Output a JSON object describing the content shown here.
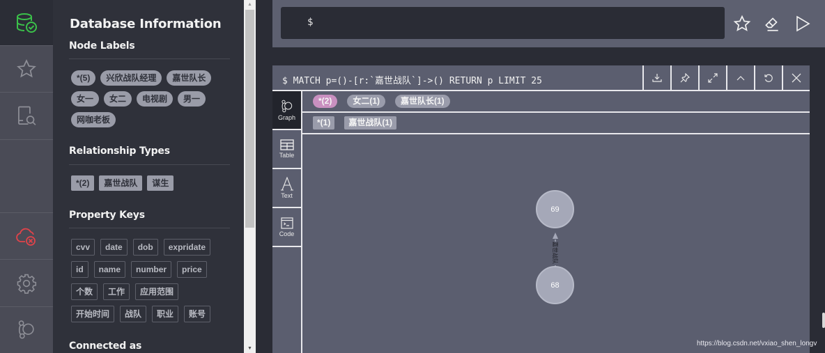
{
  "nav": {
    "items": [
      {
        "name": "database",
        "icon": "database-check-icon",
        "active": true
      },
      {
        "name": "favorites",
        "icon": "star-icon",
        "active": false
      },
      {
        "name": "documents",
        "icon": "document-search-icon",
        "active": false
      },
      {
        "name": "connection",
        "icon": "cloud-disconnected-icon",
        "active": false
      },
      {
        "name": "settings",
        "icon": "gear-icon",
        "active": false
      },
      {
        "name": "about",
        "icon": "neo4j-graph-icon",
        "active": false
      }
    ],
    "colors": {
      "db_ok": "#3bc14a",
      "disconnected": "#e0434a",
      "inactive": "#8e8f97"
    }
  },
  "drawer": {
    "title": "Database Information",
    "node_labels": {
      "heading": "Node Labels",
      "items": [
        "*(5)",
        "兴欣战队经理",
        "嘉世队长",
        "女一",
        "女二",
        "电视剧",
        "男一",
        "网咖老板"
      ]
    },
    "relationship_types": {
      "heading": "Relationship Types",
      "items": [
        "*(2)",
        "嘉世战队",
        "谋生"
      ]
    },
    "property_keys": {
      "heading": "Property Keys",
      "items": [
        "cvv",
        "date",
        "dob",
        "expridate",
        "id",
        "name",
        "number",
        "price",
        "个数",
        "工作",
        "应用范围",
        "开始时间",
        "战队",
        "职业",
        "账号"
      ]
    },
    "connected_as": "Connected as"
  },
  "editor": {
    "prompt": "$",
    "value": "",
    "actions": {
      "favorite": "star-icon",
      "clear": "eraser-icon",
      "run": "play-icon"
    }
  },
  "frame": {
    "query": "$ MATCH p=()-[r:`嘉世战队`]->() RETURN p LIMIT 25",
    "buttons": [
      "download-icon",
      "pin-icon",
      "expand-icon",
      "collapse-icon",
      "rerun-icon",
      "close-icon"
    ],
    "tabs": [
      {
        "label": "Graph",
        "icon": "graph-icon",
        "active": true
      },
      {
        "label": "Table",
        "icon": "table-icon",
        "active": false
      },
      {
        "label": "Text",
        "icon": "text-icon",
        "active": false
      },
      {
        "label": "Code",
        "icon": "code-icon",
        "active": false
      }
    ],
    "node_legend": [
      {
        "label": "*(2)",
        "color": "#c990c0"
      },
      {
        "label": "女二(1)",
        "color": "#9a9cab"
      },
      {
        "label": "嘉世队长(1)",
        "color": "#9a9cab"
      }
    ],
    "rel_legend": [
      {
        "label": "*(1)"
      },
      {
        "label": "嘉世战队(1)"
      }
    ],
    "graph": {
      "nodes": [
        {
          "id": "69",
          "label": "69"
        },
        {
          "id": "68",
          "label": "68"
        }
      ],
      "relationships": [
        {
          "from": "68",
          "to": "69",
          "type": "嘉世战队"
        }
      ]
    }
  },
  "watermark": "https://blog.csdn.net/vxiao_shen_longv"
}
